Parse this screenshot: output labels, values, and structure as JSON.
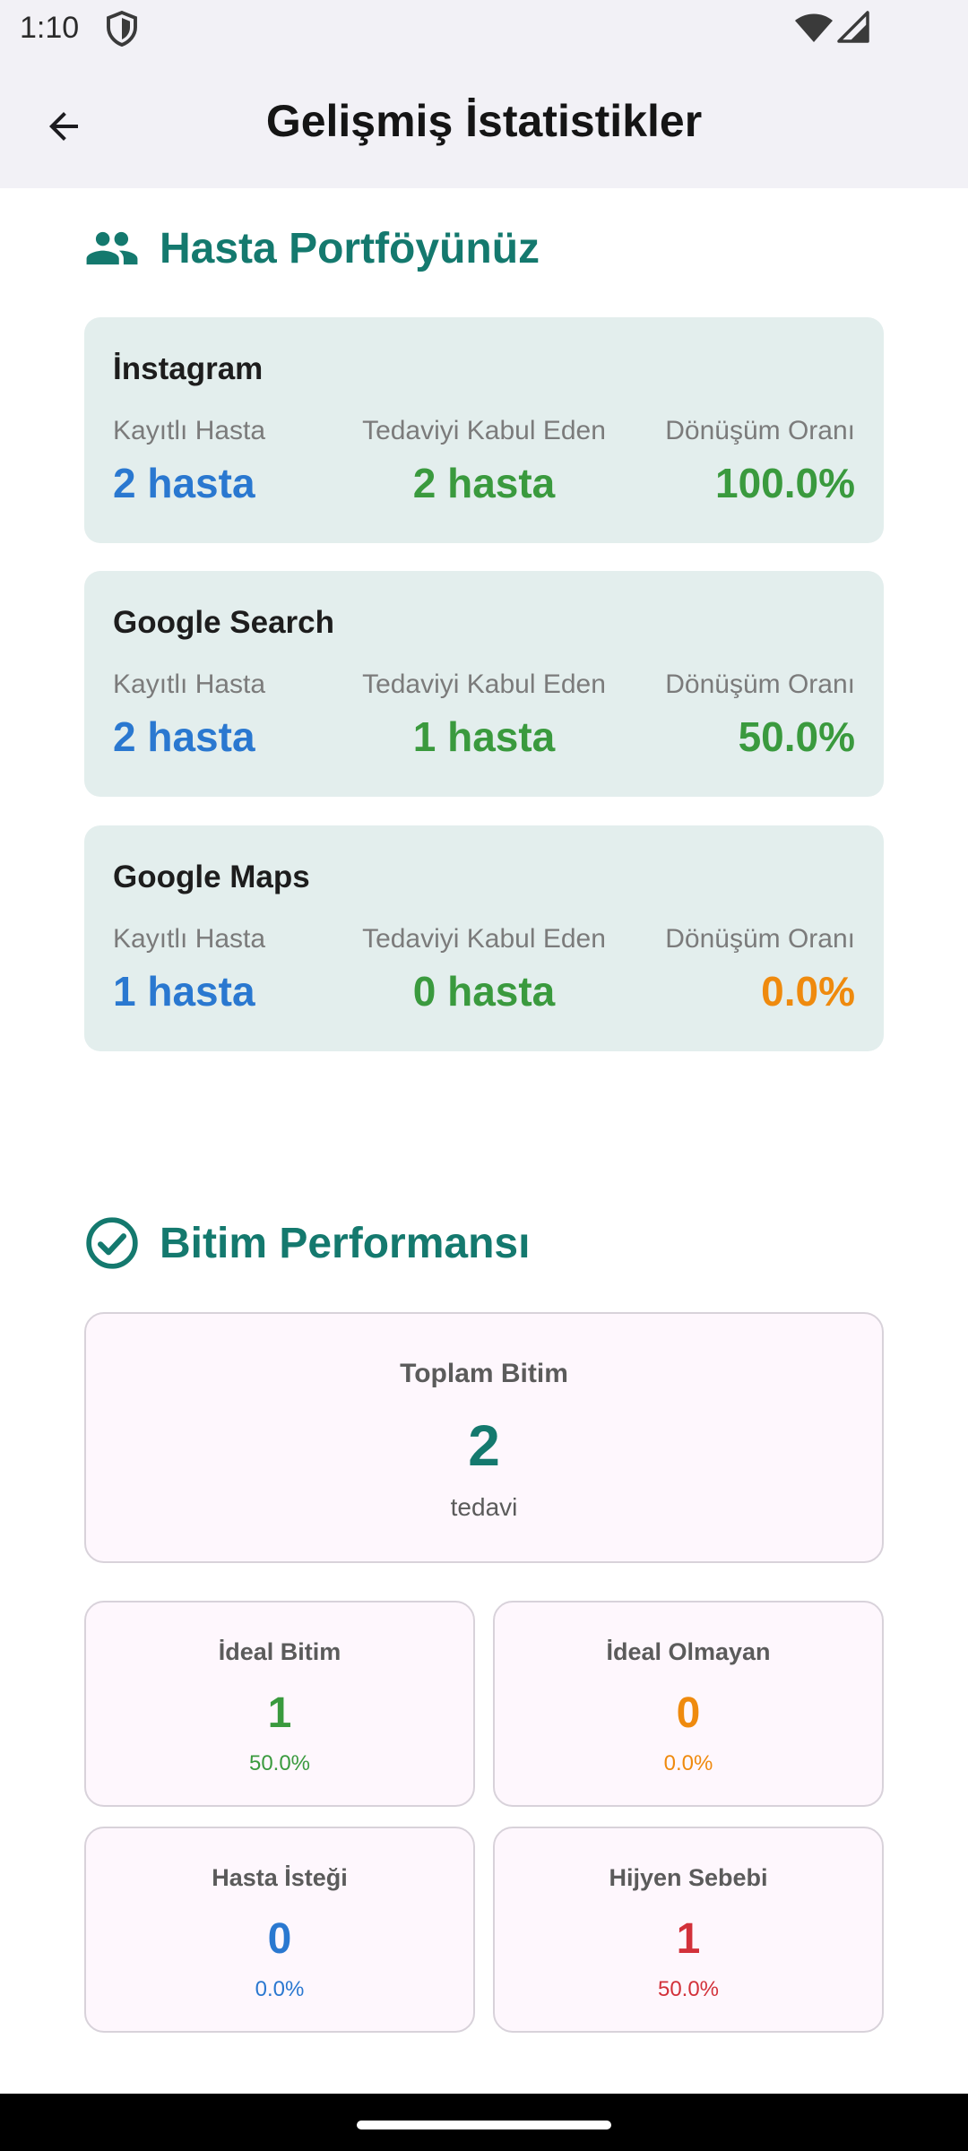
{
  "status_bar": {
    "time": "1:10"
  },
  "app_bar": {
    "title": "Gelişmiş İstatistikler"
  },
  "portfolio": {
    "header": "Hasta Portföyünüz",
    "labels": {
      "registered": "Kayıtlı Hasta",
      "accepted": "Tedaviyi Kabul Eden",
      "conversion": "Dönüşüm Oranı"
    },
    "sources": [
      {
        "name": "İnstagram",
        "registered": "2 hasta",
        "accepted": "2 hasta",
        "conversion": "100.0%"
      },
      {
        "name": "Google Search",
        "registered": "2 hasta",
        "accepted": "1 hasta",
        "conversion": "50.0%"
      },
      {
        "name": "Google Maps",
        "registered": "1 hasta",
        "accepted": "0 hasta",
        "conversion": "0.0%"
      }
    ]
  },
  "performance": {
    "header": "Bitim Performansı",
    "total": {
      "label": "Toplam Bitim",
      "value": "2",
      "unit": "tedavi"
    },
    "cards": [
      {
        "label": "İdeal Bitim",
        "value": "1",
        "percent": "50.0%"
      },
      {
        "label": "İdeal Olmayan",
        "value": "0",
        "percent": "0.0%"
      },
      {
        "label": "Hasta İsteği",
        "value": "0",
        "percent": "0.0%"
      },
      {
        "label": "Hijyen Sebebi",
        "value": "1",
        "percent": "50.0%"
      }
    ]
  },
  "colors": {
    "accent": "#14796e",
    "blue": "#2a78d0",
    "green": "#3a9a3e",
    "orange": "#ef8a0e",
    "red": "#d2313a",
    "card_bg": "#e3eeed",
    "perf_card_bg": "#fef7fd"
  },
  "icons": [
    "shield-icon",
    "wifi-icon",
    "signal-icon",
    "back-arrow-icon",
    "people-icon",
    "check-circle-icon"
  ]
}
